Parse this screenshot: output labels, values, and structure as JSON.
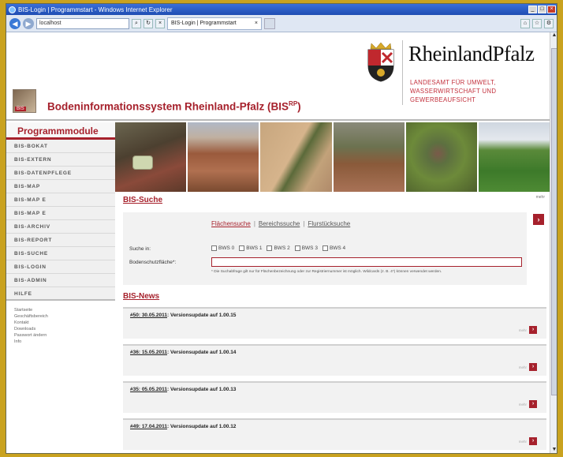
{
  "window": {
    "title": "BIS-Login | Programmstart - Windows Internet Explorer",
    "address": "localhost",
    "tab_label": "BIS-Login | Programmstart",
    "tab_close": "×",
    "controls": {
      "minimize": "_",
      "maximize": "□",
      "close": "×"
    }
  },
  "header": {
    "site_title": "Bodeninformationssystem Rheinland-Pfalz (BIS",
    "site_title_sup": "RP",
    "site_title_close": ")",
    "logo_tag": "BIS",
    "brand_name": "RheinlandPfalz",
    "brand_sub": "LANDESAMT FÜR UMWELT,\nWASSERWIRTSCHAFT UND\nGEWERBEAUFSICHT"
  },
  "sidebar": {
    "heading": "Programmmodule",
    "items": [
      {
        "label": "BIS-BOKAT"
      },
      {
        "label": "BIS-EXTERN"
      },
      {
        "label": "BIS-DATENPFLEGE"
      },
      {
        "label": "BIS-MAP"
      },
      {
        "label": "BIS-MAP E"
      },
      {
        "label": "BIS-MAP E"
      },
      {
        "label": "BIS-ARCHIV"
      },
      {
        "label": "BIS-REPORT"
      },
      {
        "label": "BIS-SUCHE"
      },
      {
        "label": "BIS-LOGIN"
      },
      {
        "label": "BIS-ADMIN"
      },
      {
        "label": "HILFE"
      }
    ],
    "links": [
      "Startseite",
      "Geschäftsbereich",
      "Kontakt",
      "Downloads",
      "Passwort ändern",
      "Info"
    ]
  },
  "search": {
    "title": "BIS-Suche",
    "more_label": "mehr",
    "tabs": [
      {
        "label": "Flächensuche"
      },
      {
        "label": "Bereichssuche"
      },
      {
        "label": "Flurstücksuche"
      }
    ],
    "suche_label": "Suche in:",
    "bws_options": [
      "BWS 0",
      "BWS 1",
      "BWS 2",
      "BWS 3",
      "BWS 4"
    ],
    "field_label": "Bodenschutzfläche*:",
    "field_value": "",
    "hint": "* Die Suchabfrage gilt nur für Flächenbezeichnung oder zur Registriernummer ist möglich. Wildcards (z. B. 4*) können verwendet werden.",
    "go_label": "›"
  },
  "news": {
    "title": "BIS-News",
    "more_label": "mehr",
    "items": [
      {
        "id": "#50: 30.05.2011",
        "text": ": Versionsupdate auf 1.00.15"
      },
      {
        "id": "#36: 15.05.2011",
        "text": ": Versionsupdate auf 1.00.14"
      },
      {
        "id": "#35: 05.05.2011",
        "text": ": Versionsupdate auf 1.00.13"
      },
      {
        "id": "#49: 17.04.2011",
        "text": ": Versionsupdate auf 1.00.12"
      }
    ]
  },
  "colors": {
    "accent": "#a6212c",
    "panel": "#f2f2f2",
    "desktop": "#c9a21f"
  }
}
